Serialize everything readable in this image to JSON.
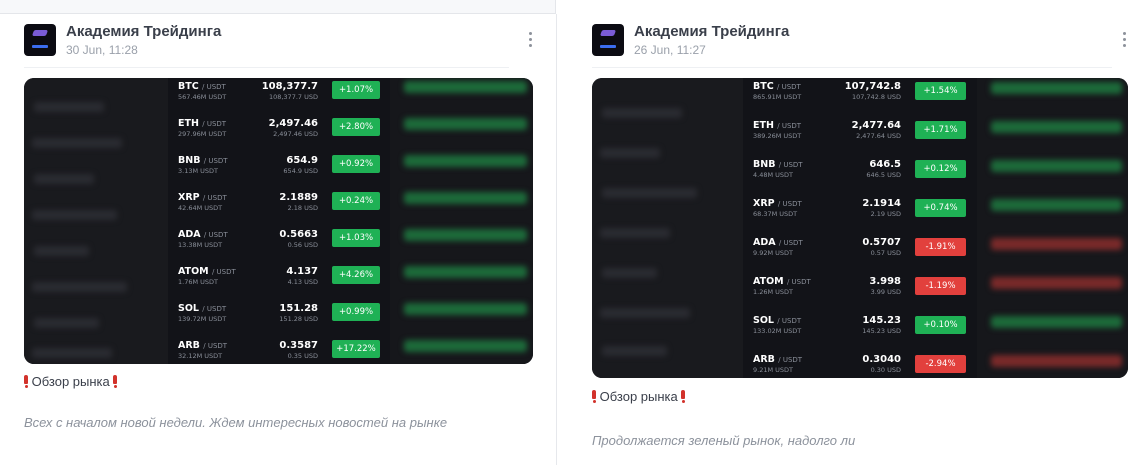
{
  "colors": {
    "up": "#1fb155",
    "down": "#e2403d",
    "panel": "#121318",
    "bang": "#d2322b"
  },
  "posts": [
    {
      "channel_name": "Академия Трейдинга",
      "date": "30 Jun, 11:28",
      "title": "Обзор рынка",
      "text": "Всех с началом новой недели. Ждем интересных новостей на рынке",
      "quote_label": "/ USDT",
      "tickers": [
        {
          "symbol": "BTC",
          "volume": "567.46M USDT",
          "price": "108,377.7",
          "sub": "108,377.7 USD",
          "change": "+1.07%",
          "trend": "up"
        },
        {
          "symbol": "ETH",
          "volume": "297.96M USDT",
          "price": "2,497.46",
          "sub": "2,497.46 USD",
          "change": "+2.80%",
          "trend": "up"
        },
        {
          "symbol": "BNB",
          "volume": "3.13M USDT",
          "price": "654.9",
          "sub": "654.9 USD",
          "change": "+0.92%",
          "trend": "up"
        },
        {
          "symbol": "XRP",
          "volume": "42.64M USDT",
          "price": "2.1889",
          "sub": "2.18 USD",
          "change": "+0.24%",
          "trend": "up"
        },
        {
          "symbol": "ADA",
          "volume": "13.38M USDT",
          "price": "0.5663",
          "sub": "0.56 USD",
          "change": "+1.03%",
          "trend": "up"
        },
        {
          "symbol": "ATOM",
          "volume": "1.76M USDT",
          "price": "4.137",
          "sub": "4.13 USD",
          "change": "+4.26%",
          "trend": "up"
        },
        {
          "symbol": "SOL",
          "volume": "139.72M USDT",
          "price": "151.28",
          "sub": "151.28 USD",
          "change": "+0.99%",
          "trend": "up"
        },
        {
          "symbol": "ARB",
          "volume": "32.12M USDT",
          "price": "0.3587",
          "sub": "0.35 USD",
          "change": "+17.22%",
          "trend": "up"
        }
      ]
    },
    {
      "channel_name": "Академия Трейдинга",
      "date": "26 Jun, 11:27",
      "title": "Обзор рынка",
      "text": "Продолжается зеленый рынок, надолго ли",
      "quote_label": "/ USDT",
      "tickers": [
        {
          "symbol": "BTC",
          "volume": "865.91M USDT",
          "price": "107,742.8",
          "sub": "107,742.8 USD",
          "change": "+1.54%",
          "trend": "up"
        },
        {
          "symbol": "ETH",
          "volume": "389.26M USDT",
          "price": "2,477.64",
          "sub": "2,477.64 USD",
          "change": "+1.71%",
          "trend": "up"
        },
        {
          "symbol": "BNB",
          "volume": "4.48M USDT",
          "price": "646.5",
          "sub": "646.5 USD",
          "change": "+0.12%",
          "trend": "up"
        },
        {
          "symbol": "XRP",
          "volume": "68.37M USDT",
          "price": "2.1914",
          "sub": "2.19 USD",
          "change": "+0.74%",
          "trend": "up"
        },
        {
          "symbol": "ADA",
          "volume": "9.92M USDT",
          "price": "0.5707",
          "sub": "0.57 USD",
          "change": "-1.91%",
          "trend": "down"
        },
        {
          "symbol": "ATOM",
          "volume": "1.26M USDT",
          "price": "3.998",
          "sub": "3.99 USD",
          "change": "-1.19%",
          "trend": "down"
        },
        {
          "symbol": "SOL",
          "volume": "133.02M USDT",
          "price": "145.23",
          "sub": "145.23 USD",
          "change": "+0.10%",
          "trend": "up"
        },
        {
          "symbol": "ARB",
          "volume": "9.21M USDT",
          "price": "0.3040",
          "sub": "0.30 USD",
          "change": "-2.94%",
          "trend": "down"
        }
      ]
    }
  ]
}
